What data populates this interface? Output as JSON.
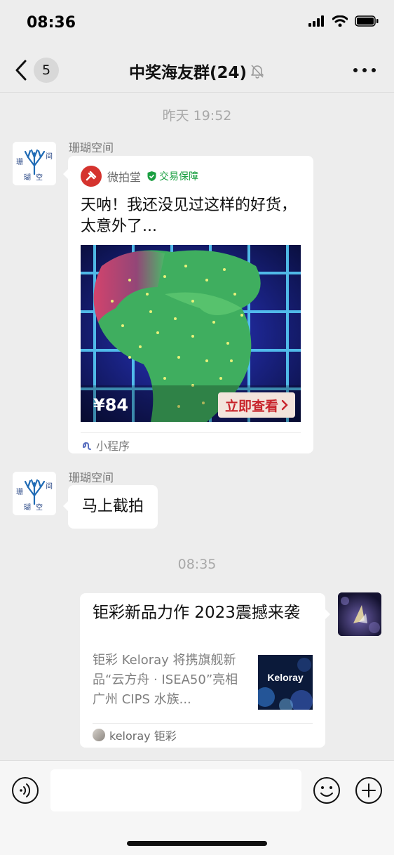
{
  "status_bar": {
    "time": "08:36",
    "icons": [
      "signal-icon",
      "wifi-icon",
      "battery-icon"
    ]
  },
  "nav": {
    "back_badge": "5",
    "title": "中奖海友群(24)",
    "mute_icon": "bell-slash-icon"
  },
  "timestamps": {
    "first": "昨天 19:52",
    "second": "08:35"
  },
  "messages": {
    "m1": {
      "sender": "珊瑚空间",
      "mini_program": {
        "source": "微拍堂",
        "guarantee": "交易保障",
        "title": "天呐！我还没见过这样的好货，太意外了...",
        "price": "¥84",
        "view_label": "立即查看",
        "footer": "小程序"
      }
    },
    "m2": {
      "sender": "珊瑚空间",
      "text": "马上截拍"
    },
    "m3": {
      "article": {
        "title": "钜彩新品力作 2023震撼来袭",
        "desc": "钜彩 Keloray 将携旗舰新品“云方舟 · ISEA50”亮相广州 CIPS 水族...",
        "thumb_text": "Keloray",
        "source": "keloray 钜彩"
      }
    }
  },
  "avatar_label": "珊瑚空间",
  "colors": {
    "background": "#ededed",
    "brand_red": "#c8242b",
    "guarantee_green": "#1a9f41",
    "timestamp": "#a8a8a8"
  }
}
